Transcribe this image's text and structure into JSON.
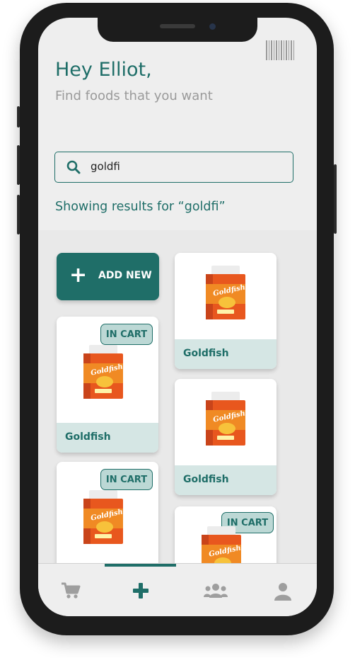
{
  "header": {
    "greeting": "Hey Elliot,",
    "subtitle": "Find foods that you want"
  },
  "search": {
    "value": "goldfi",
    "icon": "search-icon"
  },
  "results_heading": "Showing results for “goldfi”",
  "add_new_label": "ADD NEW",
  "products": [
    {
      "name": "Goldfish",
      "badge": "IN CART"
    },
    {
      "name": "Goldfish",
      "badge": ""
    },
    {
      "name": "Goldfish",
      "badge": ""
    },
    {
      "name": "",
      "badge": "IN CART"
    },
    {
      "name": "",
      "badge": "IN CART"
    }
  ],
  "bottom_nav": [
    {
      "icon": "cart-icon",
      "active": false
    },
    {
      "icon": "plus-icon",
      "active": true
    },
    {
      "icon": "group-icon",
      "active": false
    },
    {
      "icon": "profile-icon",
      "active": false
    }
  ],
  "colors": {
    "accent": "#1f6e68",
    "badge_bg": "#bcd8d5",
    "label_bg": "#d5e6e4",
    "background": "#eeeeee"
  }
}
